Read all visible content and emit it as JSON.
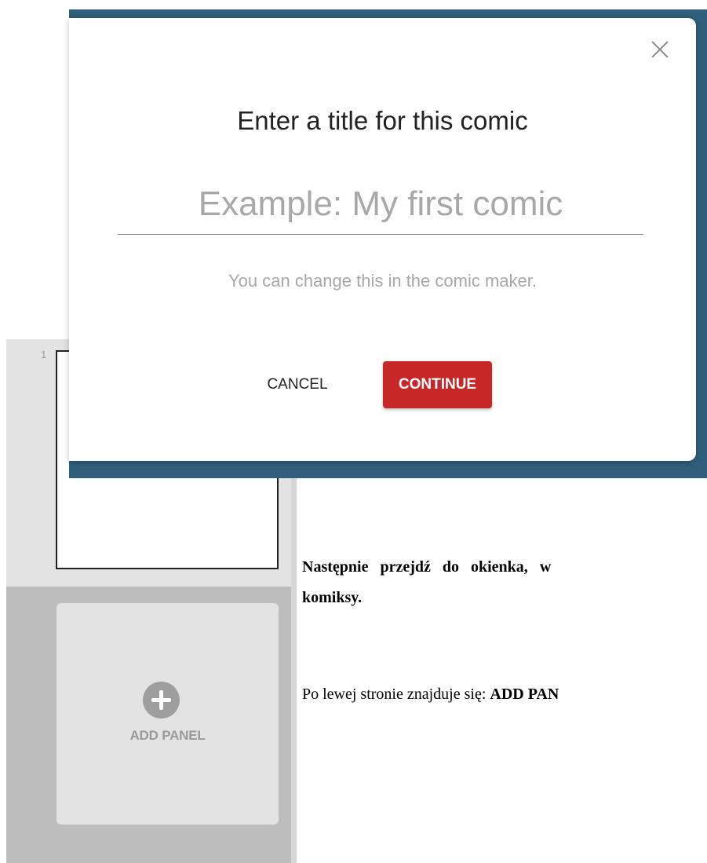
{
  "sidebar": {
    "panel_number": "1",
    "add_panel_label": "ADD PANEL"
  },
  "document": {
    "heading_line1_words": [
      "Następnie",
      "przejdź",
      "do",
      "okienka,",
      "w"
    ],
    "heading_line2": "komiksy.",
    "body_prefix": "Po lewej stronie znajduje się: ",
    "body_bold": "ADD PAN"
  },
  "modal": {
    "title": "Enter a title for this comic",
    "input_value": "",
    "input_placeholder": "Example: My first comic",
    "hint": "You can change this in the comic maker.",
    "cancel_label": "CANCEL",
    "continue_label": "CONTINUE"
  },
  "colors": {
    "overlay": "#2f5f7a",
    "accent": "#c62828"
  },
  "icons": {
    "close": "close-icon",
    "add": "plus-circle-icon"
  }
}
